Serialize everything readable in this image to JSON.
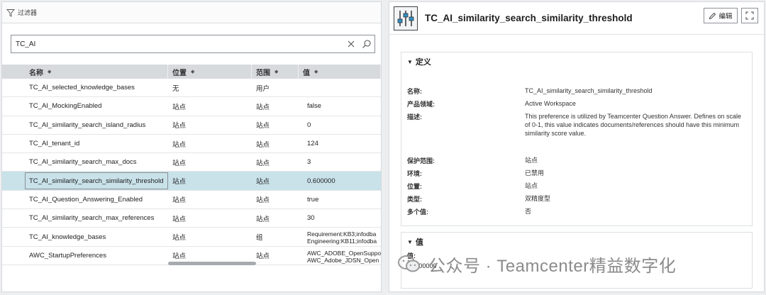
{
  "filter": {
    "label": "过滤器"
  },
  "search": {
    "value": "TC_AI"
  },
  "table": {
    "headers": [
      "名称",
      "位置",
      "范围",
      "值"
    ],
    "rows": [
      {
        "name": "TC_AI_selected_knowledge_bases",
        "location": "无",
        "scope": "用户",
        "value": ""
      },
      {
        "name": "TC_AI_MockingEnabled",
        "location": "站点",
        "scope": "站点",
        "value": "false"
      },
      {
        "name": "TC_AI_similarity_search_island_radius",
        "location": "站点",
        "scope": "站点",
        "value": "0"
      },
      {
        "name": "TC_AI_tenant_id",
        "location": "站点",
        "scope": "站点",
        "value": "124"
      },
      {
        "name": "TC_AI_similarity_search_max_docs",
        "location": "站点",
        "scope": "站点",
        "value": "3"
      },
      {
        "name": "TC_AI_similarity_search_similarity_threshold",
        "location": "站点",
        "scope": "站点",
        "value": "0.600000"
      },
      {
        "name": "TC_AI_Question_Answering_Enabled",
        "location": "站点",
        "scope": "站点",
        "value": "true"
      },
      {
        "name": "TC_AI_similarity_search_max_references",
        "location": "站点",
        "scope": "站点",
        "value": "30"
      },
      {
        "name": "TC_AI_knowledge_bases",
        "location": "站点",
        "scope": "组",
        "value": "Requirement:KB3;infodba",
        "value2": "Engineering:KB11;infodba"
      },
      {
        "name": "AWC_StartupPreferences",
        "location": "站点",
        "scope": "站点",
        "value": "AWC_ADOBE_OpenSupport",
        "value2": "AWC_Adobe_JDSN_Open"
      }
    ]
  },
  "detail": {
    "title": "TC_AI_similarity_search_similarity_threshold",
    "edit_label": "编辑",
    "definition": {
      "title": "定义",
      "name_label": "名称:",
      "name": "TC_AI_similarity_search_similarity_threshold",
      "product_area_label": "产品领域:",
      "product_area": "Active Workspace",
      "description_label": "描述:",
      "description": "This preference is utilized by Teamcenter Question Answer. Defines on scale of 0-1, this value indicates documents/references should have this minimum similarity score value.",
      "protection_scope_label": "保护范围:",
      "protection_scope": "站点",
      "environment_label": "环境:",
      "environment": "已禁用",
      "location_label": "位置:",
      "location": "站点",
      "type_label": "类型:",
      "type": "双精度型",
      "multi_value_label": "多个值:",
      "multi_value": "否"
    },
    "value_section": {
      "title": "值",
      "label": "值:",
      "value": "0.600000"
    }
  },
  "watermark": {
    "text": "公众号 · Teamcenter精益数字化"
  },
  "colors": {
    "selected_row": "#c9e2ea",
    "header_bg": "#d7dadd",
    "watermark": "#8b8b8b"
  }
}
